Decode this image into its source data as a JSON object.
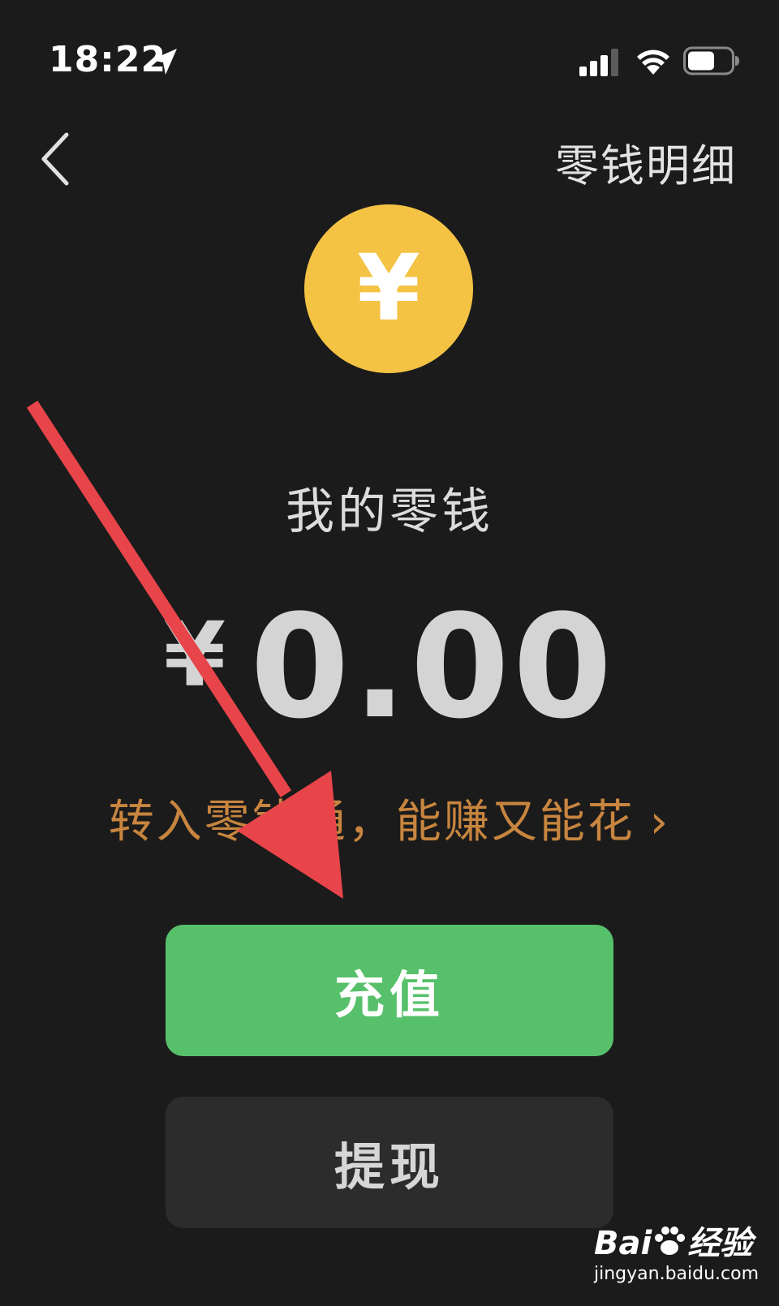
{
  "status_bar": {
    "time": "18:22",
    "icons": [
      "location-arrow-icon",
      "cellular-signal-icon",
      "wifi-icon",
      "battery-icon"
    ]
  },
  "nav": {
    "back_icon": "chevron-left-icon",
    "detail_link": "零钱明细"
  },
  "wallet": {
    "coin_symbol": "¥",
    "title": "我的零钱",
    "currency_symbol": "¥",
    "balance": "0.00",
    "promo_text": "转入零钱通，能赚又能花",
    "promo_chevron": "›"
  },
  "actions": {
    "recharge_label": "充值",
    "withdraw_label": "提现"
  },
  "annotation": {
    "arrow_color": "#e8454a"
  },
  "watermark": {
    "brand": "Bai",
    "brand_suffix": "经验",
    "url": "jingyan.baidu.com"
  },
  "colors": {
    "background": "#1b1b1b",
    "coin": "#f4c344",
    "promo": "#c8853f",
    "primary_button": "#56c06a",
    "secondary_button": "#2c2c2c"
  }
}
